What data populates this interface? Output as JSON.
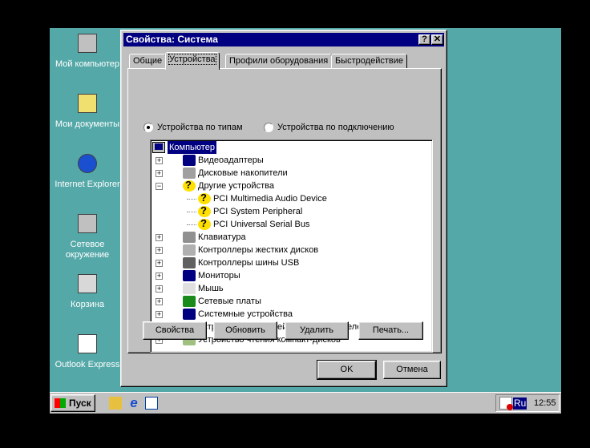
{
  "desktop": {
    "icons": [
      {
        "label": "Мой компьютер",
        "icon": "my-computer-icon"
      },
      {
        "label": "Мои документы",
        "icon": "folder-icon"
      },
      {
        "label": "Internet Explorer",
        "icon": "ie-icon"
      },
      {
        "label": "Сетевое окружение",
        "icon": "network-icon"
      },
      {
        "label": "Корзина",
        "icon": "recycle-bin-icon"
      },
      {
        "label": "Outlook Express",
        "icon": "outlook-icon"
      }
    ]
  },
  "window": {
    "title": "Свойства: Система",
    "help": "?",
    "close": "✕",
    "tabs": [
      {
        "label": "Общие"
      },
      {
        "label": "Устройства"
      },
      {
        "label": "Профили оборудования"
      },
      {
        "label": "Быстродействие"
      }
    ],
    "radios": [
      {
        "label": "Устройства по типам",
        "checked": true
      },
      {
        "label": "Устройства по подключению",
        "checked": false
      }
    ],
    "tree": {
      "root": "Компьютер",
      "items": [
        {
          "label": "Видеоадаптеры",
          "icon": "display-adapter-icon",
          "expander": "+"
        },
        {
          "label": "Дисковые накопители",
          "icon": "disk-drive-icon",
          "expander": "+"
        },
        {
          "label": "Другие устройства",
          "icon": "unknown-device-icon",
          "expander": "−"
        },
        {
          "label": "PCI Multimedia Audio Device",
          "icon": "unknown-device-icon",
          "child": true
        },
        {
          "label": "PCI System Peripheral",
          "icon": "unknown-device-icon",
          "child": true
        },
        {
          "label": "PCI Universal Serial Bus",
          "icon": "unknown-device-icon",
          "child": true
        },
        {
          "label": "Клавиатура",
          "icon": "keyboard-icon",
          "expander": "+"
        },
        {
          "label": "Контроллеры жестких дисков",
          "icon": "hdd-controller-icon",
          "expander": "+"
        },
        {
          "label": "Контроллеры шины USB",
          "icon": "usb-icon",
          "expander": "+"
        },
        {
          "label": "Мониторы",
          "icon": "monitor-icon",
          "expander": "+"
        },
        {
          "label": "Мышь",
          "icon": "mouse-icon",
          "expander": "+"
        },
        {
          "label": "Сетевые платы",
          "icon": "network-card-icon",
          "expander": "+"
        },
        {
          "label": "Системные устройства",
          "icon": "system-device-icon",
          "expander": "+"
        },
        {
          "label": "Устройства интерфейса с пользователем",
          "icon": "hid-icon",
          "expander": "+"
        },
        {
          "label": "Устройство чтения компакт-дисков",
          "icon": "cdrom-icon",
          "expander": "+"
        }
      ]
    },
    "buttons": {
      "properties": "Свойства",
      "refresh": "Обновить",
      "remove": "Удалить",
      "print": "Печать...",
      "ok": "OK",
      "cancel": "Отмена"
    }
  },
  "taskbar": {
    "start": "Пуск",
    "lang": "Ru",
    "clock": "12:55"
  }
}
